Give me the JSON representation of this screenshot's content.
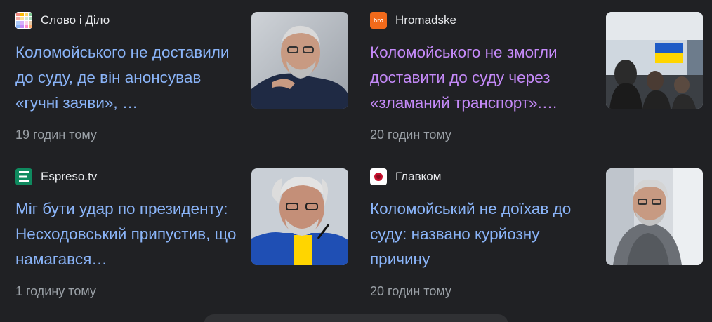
{
  "articles": [
    {
      "source": "Слово і Діло",
      "title": "Коломойського не доставили до суду, де він анонсував «гучні заяви», …",
      "time": "19 годин тому",
      "visited": false,
      "logo": "slovo-i-dilo-grid-logo",
      "thumbnail": "kolomoisky-portrait"
    },
    {
      "source": "Hromadske",
      "title": "Коломойського не змогли доставити до суду через «зламаний транспорт».…",
      "time": "20 годин тому",
      "visited": true,
      "logo": "hromadske-hro-logo",
      "logo_text": "hro",
      "thumbnail": "courtroom-photo"
    },
    {
      "source": "Espreso.tv",
      "title": "Міг бути удар по президенту: Несходовський припустив, що намагався…",
      "time": "1 годину тому",
      "visited": false,
      "logo": "espreso-e-logo",
      "thumbnail": "kolomoisky-portrait"
    },
    {
      "source": "Главком",
      "title": "Коломойський не доїхав до суду: названо курйозну причину",
      "time": "20 годин тому",
      "visited": false,
      "logo": "glavcom-red-dot-logo",
      "thumbnail": "kolomoisky-court-photo"
    }
  ],
  "colors": {
    "background": "#202124",
    "link": "#8ab4f8",
    "visited_link": "#c58af9",
    "source_text": "#e8eaed",
    "time_text": "#9aa0a6",
    "divider": "#3c4043"
  }
}
